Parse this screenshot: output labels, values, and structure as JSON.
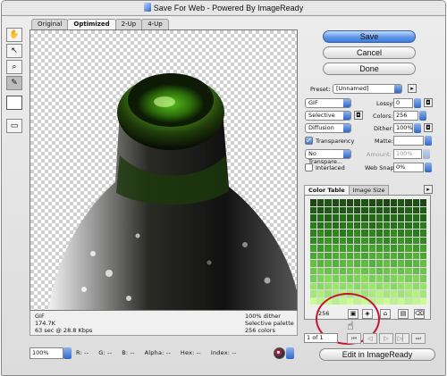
{
  "window": {
    "title": "Save For Web - Powered By ImageReady"
  },
  "tabs": [
    {
      "label": "Original",
      "active": false
    },
    {
      "label": "Optimized",
      "active": true
    },
    {
      "label": "2-Up",
      "active": false
    },
    {
      "label": "4-Up",
      "active": false
    }
  ],
  "tools": [
    "hand-tool",
    "slice-select-tool",
    "zoom-tool",
    "eyedropper-tool"
  ],
  "buttons": {
    "save": "Save",
    "cancel": "Cancel",
    "done": "Done",
    "edit_imageready": "Edit in ImageReady"
  },
  "settings": {
    "preset_label": "Preset:",
    "preset_value": "[Unnamed]",
    "format": "GIF",
    "lossy_label": "Lossy:",
    "lossy_value": "0",
    "palette": "Selective",
    "colors_label": "Colors:",
    "colors_value": "256",
    "dither_method": "Diffusion",
    "dither_label": "Dither:",
    "dither_value": "100%",
    "transparency_label": "Transparency",
    "transparency_checked": true,
    "matte_label": "Matte:",
    "trans_dither": "No Transpare...",
    "amount_label": "Amount:",
    "amount_value": "100%",
    "interlaced_label": "Interlaced",
    "interlaced_checked": false,
    "websnap_label": "Web Snap:",
    "websnap_value": "0%"
  },
  "panel_tabs": [
    {
      "label": "Color Table",
      "active": true
    },
    {
      "label": "Image Size",
      "active": false
    }
  ],
  "color_table": {
    "count": "256"
  },
  "animation": {
    "frame": "1 of 1"
  },
  "info_left": {
    "format": "GIF",
    "size": "174.7K",
    "time": "63 sec @ 28.8 Kbps"
  },
  "info_right": {
    "dither": "100% dither",
    "palette": "Selective palette",
    "colors": "256 colors"
  },
  "status": {
    "zoom": "100%",
    "r": "R:  --",
    "g": "G:  --",
    "b": "B:  --",
    "alpha": "Alpha:  --",
    "hex": "Hex:  --",
    "index": "Index:  --"
  },
  "colors": {
    "accent": "#5e95e6",
    "highlight": "#c4132d"
  }
}
